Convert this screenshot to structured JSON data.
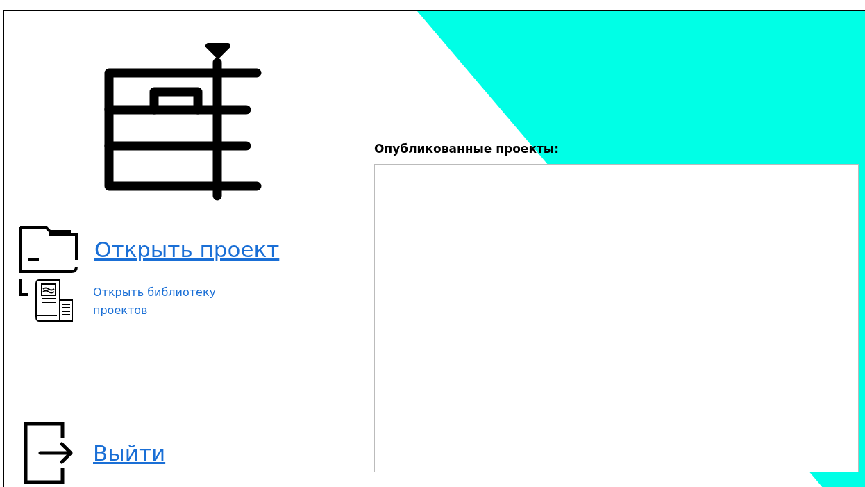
{
  "links": [
    {
      "kind": "folder",
      "label": "Открыть проект"
    },
    {
      "kind": "library",
      "label": "Открыть библиотеку проектов"
    }
  ],
  "exit": {
    "label": "Выйти"
  },
  "published": {
    "title": "Опубликованные проекты:"
  }
}
